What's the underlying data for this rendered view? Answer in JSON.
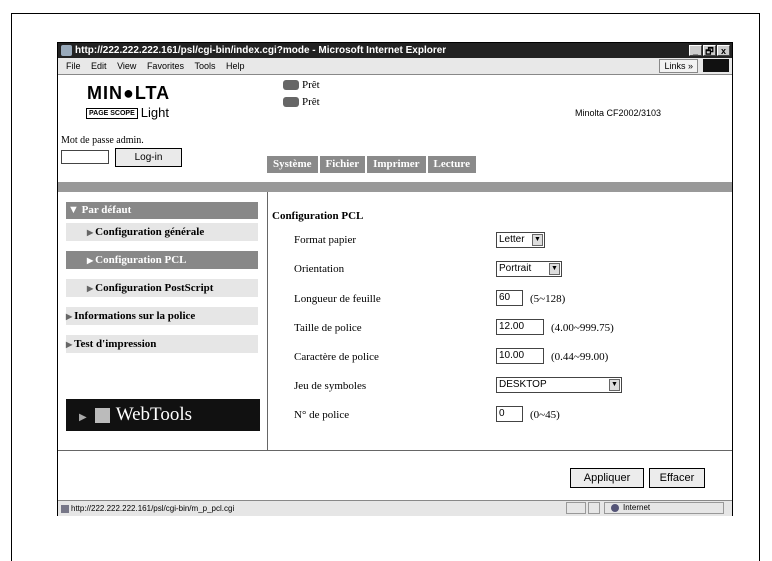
{
  "window": {
    "title": "http://222.222.222.161/psl/cgi-bin/index.cgi?mode - Microsoft Internet Explorer",
    "controls": [
      "_",
      "🗗",
      "x"
    ]
  },
  "menu": {
    "items": [
      "File",
      "Edit",
      "View",
      "Favorites",
      "Tools",
      "Help"
    ],
    "links": "Links »"
  },
  "header": {
    "logo": "MIN●LTA",
    "logo2_badge": "PAGE SCOPE",
    "logo2_text": "Light",
    "password_label": "Mot de passe admin.",
    "password_value": "",
    "login_button": "Log-in",
    "status1": "Prêt",
    "status2": "Prêt",
    "model": "Minolta CF2002/3103"
  },
  "tabs": [
    "Système",
    "Fichier",
    "Imprimer",
    "Lecture"
  ],
  "sidebar": {
    "head": "▼ Par défaut",
    "items": [
      {
        "label": "Configuration générale"
      },
      {
        "label": "Configuration PCL"
      },
      {
        "label": "Configuration PostScript"
      },
      {
        "label": "Informations sur la police"
      },
      {
        "label": "Test d'impression"
      }
    ],
    "webtools": "WebTools"
  },
  "main": {
    "title": "Configuration PCL",
    "rows": [
      {
        "label": "Format papier",
        "value": "Letter",
        "range": ""
      },
      {
        "label": "Orientation",
        "value": "Portrait",
        "range": ""
      },
      {
        "label": "Longueur de feuille",
        "value": "60",
        "range": "(5~128)"
      },
      {
        "label": "Taille de police",
        "value": "12.00",
        "range": "(4.00~999.75)"
      },
      {
        "label": "Caractère de police",
        "value": "10.00",
        "range": "(0.44~99.00)"
      },
      {
        "label": "Jeu de symboles",
        "value": "DESKTOP",
        "range": ""
      },
      {
        "label": "N° de police",
        "value": "0",
        "range": "(0~45)"
      }
    ],
    "apply_button": "Appliquer",
    "clear_button": "Effacer"
  },
  "statusbar": {
    "url": "http://222.222.222.161/psl/cgi-bin/m_p_pcl.cgi",
    "zone": "Internet"
  }
}
